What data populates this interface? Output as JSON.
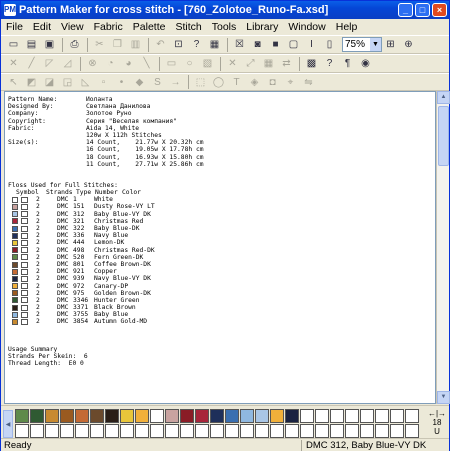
{
  "window": {
    "title": "Pattern Maker for cross stitch - [760_Zolotoe_Runo-Fa.xsd]",
    "icon_label": "PM",
    "controls": {
      "minimize": "_",
      "maximize": "□",
      "close": "×"
    }
  },
  "menu": [
    "File",
    "Edit",
    "View",
    "Fabric",
    "Palette",
    "Stitch",
    "Tools",
    "Library",
    "Window",
    "Help"
  ],
  "toolbar1": {
    "zoom_value": "75%"
  },
  "pattern_info": [
    {
      "label": "Pattern Name:",
      "value": "Иоланта"
    },
    {
      "label": "Designed By:",
      "value": "Светлана Данилова"
    },
    {
      "label": "Company:",
      "value": "Золотое Руно"
    },
    {
      "label": "Copyright:",
      "value": "Серия \"Веселая компания\""
    },
    {
      "label": "Fabric:",
      "value": "Aida 14, White"
    },
    {
      "label": "",
      "value": "120w X 112h Stitches"
    },
    {
      "label": "Size(s):",
      "value": "14 Count,    21.77w X 20.32h cm"
    },
    {
      "label": "",
      "value": "16 Count,    19.05w X 17.78h cm"
    },
    {
      "label": "",
      "value": "18 Count,    16.93w X 15.80h cm"
    },
    {
      "label": "",
      "value": "11 Count,    27.71w X 25.86h cm"
    }
  ],
  "floss": {
    "heading": "Floss Used for Full Stitches:",
    "header": {
      "symbol": "Symbol",
      "strands": "Strands",
      "type": "Type",
      "number": "Number",
      "color": "Color"
    },
    "rows": [
      {
        "color_hex": "#ffffff",
        "strands": "2",
        "type": "DMC",
        "number": "1",
        "name": "White"
      },
      {
        "color_hex": "#c9a3a0",
        "strands": "2",
        "type": "DMC",
        "number": "151",
        "name": "Dusty Rose-VY LT"
      },
      {
        "color_hex": "#a9c6e6",
        "strands": "2",
        "type": "DMC",
        "number": "312",
        "name": "Baby Blue-VY DK"
      },
      {
        "color_hex": "#a8253a",
        "strands": "2",
        "type": "DMC",
        "number": "321",
        "name": "Christmas Red"
      },
      {
        "color_hex": "#3a6fb0",
        "strands": "2",
        "type": "DMC",
        "number": "322",
        "name": "Baby Blue-DK"
      },
      {
        "color_hex": "#1e2f5a",
        "strands": "2",
        "type": "DMC",
        "number": "336",
        "name": "Navy Blue"
      },
      {
        "color_hex": "#e8c63a",
        "strands": "2",
        "type": "DMC",
        "number": "444",
        "name": "Lemon-DK"
      },
      {
        "color_hex": "#8a1c26",
        "strands": "2",
        "type": "DMC",
        "number": "498",
        "name": "Christmas Red-DK"
      },
      {
        "color_hex": "#5f8a4a",
        "strands": "2",
        "type": "DMC",
        "number": "520",
        "name": "Fern Green-DK"
      },
      {
        "color_hex": "#6b4a2c",
        "strands": "2",
        "type": "DMC",
        "number": "801",
        "name": "Coffee Brown-DK"
      },
      {
        "color_hex": "#c46a34",
        "strands": "2",
        "type": "DMC",
        "number": "921",
        "name": "Copper"
      },
      {
        "color_hex": "#1a2240",
        "strands": "2",
        "type": "DMC",
        "number": "939",
        "name": "Navy Blue-VY DK"
      },
      {
        "color_hex": "#f1b03a",
        "strands": "2",
        "type": "DMC",
        "number": "972",
        "name": "Canary-DP"
      },
      {
        "color_hex": "#9a5a20",
        "strands": "2",
        "type": "DMC",
        "number": "975",
        "name": "Golden Brown-DK"
      },
      {
        "color_hex": "#2f5a32",
        "strands": "2",
        "type": "DMC",
        "number": "3346",
        "name": "Hunter Green"
      },
      {
        "color_hex": "#2a1e16",
        "strands": "2",
        "type": "DMC",
        "number": "3371",
        "name": "Black Brown"
      },
      {
        "color_hex": "#8fb8e0",
        "strands": "2",
        "type": "DMC",
        "number": "3755",
        "name": "Baby Blue"
      },
      {
        "color_hex": "#c88a30",
        "strands": "2",
        "type": "DMC",
        "number": "3854",
        "name": "Autumn Gold-MD"
      }
    ]
  },
  "usage": {
    "heading": "Usage Summary",
    "strands_line": "Strands Per Skein:  6",
    "cut_line": "Thread Length:  E0 0"
  },
  "palette_swatches": [
    "#5f8a4a",
    "#2f5a32",
    "#c88a30",
    "#9a5a20",
    "#c46a34",
    "#6b4a2c",
    "#2a1e16",
    "#e8c63a",
    "#f1b03a",
    "#ffffff",
    "#c9a3a0",
    "#8a1c26",
    "#a8253a",
    "#1e2f5a",
    "#3a6fb0",
    "#8fb8e0",
    "#a9c6e6",
    "#f1b03a",
    "#1a2240",
    "#ffffff",
    "#ffffff",
    "#ffffff",
    "#ffffff",
    "#ffffff",
    "#ffffff",
    "#ffffff",
    "#ffffff",
    "#ffffff",
    "#ffffff",
    "#ffffff",
    "#ffffff",
    "#ffffff",
    "#ffffff",
    "#ffffff",
    "#ffffff",
    "#ffffff",
    "#ffffff",
    "#ffffff",
    "#ffffff",
    "#ffffff",
    "#ffffff",
    "#ffffff",
    "#ffffff",
    "#ffffff",
    "#ffffff",
    "#ffffff",
    "#ffffff",
    "#ffffff",
    "#ffffff",
    "#ffffff",
    "#ffffff",
    "#ffffff",
    "#ffffff",
    "#ffffff"
  ],
  "palette_controls": {
    "arrows": "←|→",
    "count": "18",
    "unit": "U"
  },
  "status": {
    "left": "Ready",
    "right": "DMC 312, Baby Blue-VY DK"
  }
}
